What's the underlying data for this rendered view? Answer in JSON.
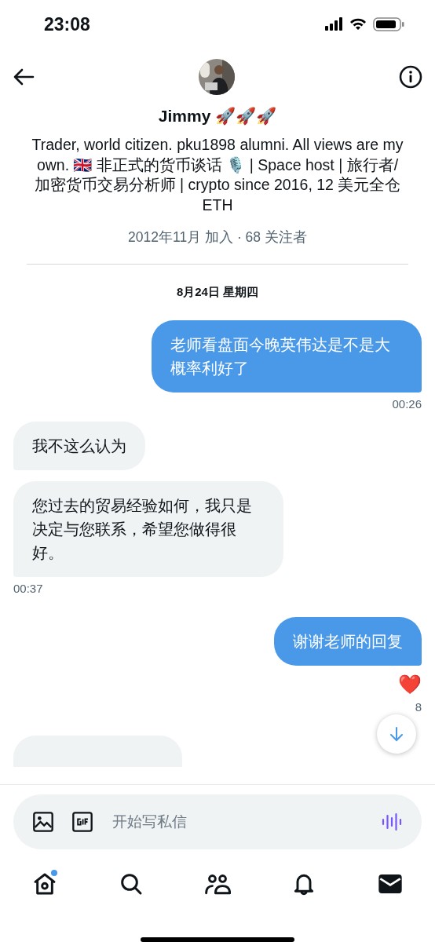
{
  "status_bar": {
    "time": "23:08"
  },
  "header": {
    "name": "Jimmy 🚀🚀🚀",
    "bio": "Trader, world citizen. pku1898 alumni. All views are my own. 🇬🇧 非正式的货币谈话 🎙️ | Space host | 旅行者/加密货币交易分析师 | crypto since 2016, 12 美元全仓 ETH",
    "meta": "2012年11月 加入 · 68 关注者"
  },
  "date_divider": "8月24日 星期四",
  "messages": [
    {
      "kind": "outgoing",
      "text": "老师看盘面今晚英伟达是不是大概率利好了",
      "time": "00:26"
    },
    {
      "kind": "incoming",
      "text": "我不这么认为"
    },
    {
      "kind": "incoming",
      "text": "您过去的贸易经验如何，我只是决定与您联系，希望您做得很好。",
      "time": "00:37"
    },
    {
      "kind": "outgoing",
      "text": "谢谢老师的回复",
      "reaction": "❤️",
      "time": "8"
    },
    {
      "kind": "partial"
    }
  ],
  "composer": {
    "placeholder": "开始写私信"
  },
  "nav": [
    {
      "kind": "home",
      "selected": false,
      "badge": true
    },
    {
      "kind": "search",
      "selected": false,
      "badge": false
    },
    {
      "kind": "people",
      "selected": false,
      "badge": false
    },
    {
      "kind": "bell",
      "selected": false,
      "badge": false
    },
    {
      "kind": "mail",
      "selected": true,
      "badge": false
    }
  ]
}
